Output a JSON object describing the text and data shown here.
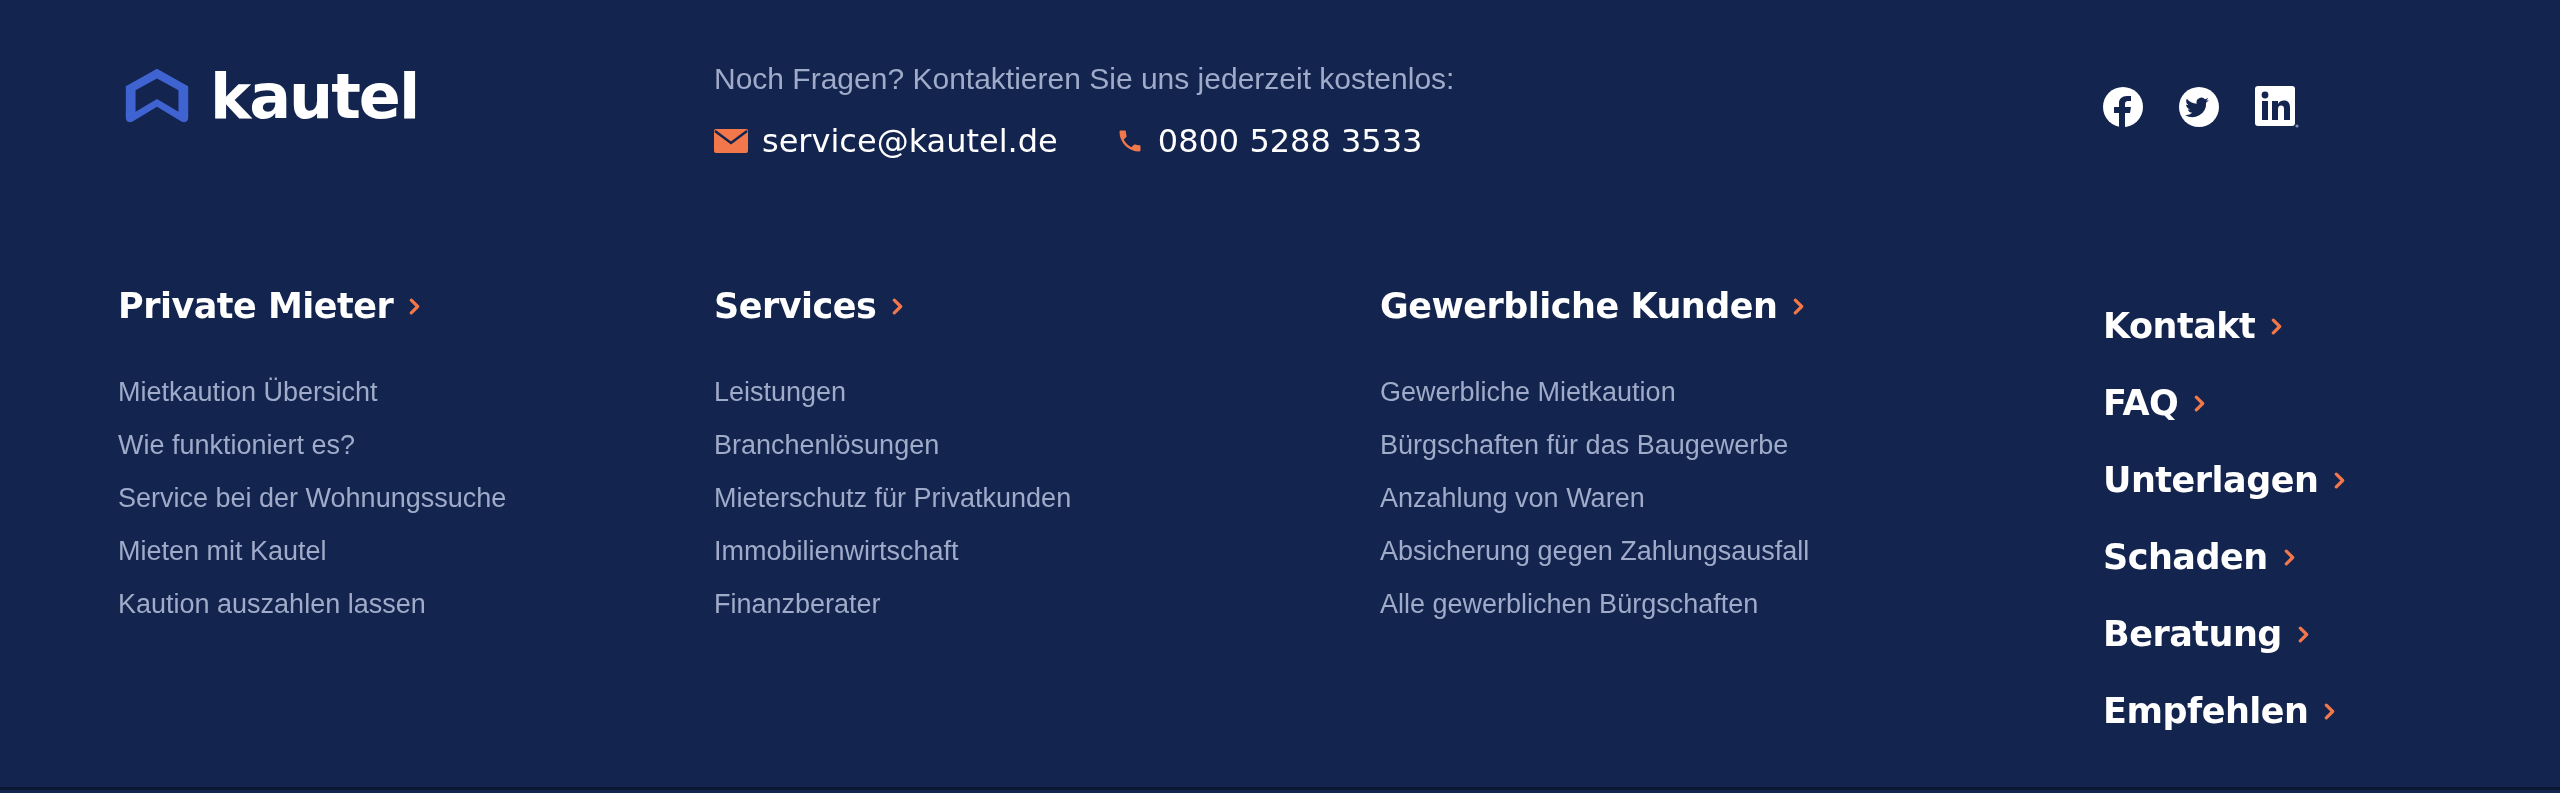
{
  "logo": {
    "text": "kautel"
  },
  "contact": {
    "headline": "Noch Fragen? Kontaktieren Sie uns jederzeit kostenlos:",
    "email": "service@kautel.de",
    "phone": "0800 5288 3533"
  },
  "social": [
    {
      "kind": "facebook"
    },
    {
      "kind": "twitter"
    },
    {
      "kind": "linkedin"
    }
  ],
  "columns": [
    {
      "title": "Private Mieter",
      "links": [
        "Mietkaution Übersicht",
        "Wie funktioniert es?",
        "Service bei der Wohnungssuche",
        "Mieten mit Kautel",
        "Kaution auszahlen lassen"
      ]
    },
    {
      "title": "Services",
      "links": [
        "Leistungen",
        "Branchenlösungen",
        "Mieterschutz für Privatkunden",
        "Immobilienwirtschaft",
        "Finanzberater"
      ]
    },
    {
      "title": "Gewerbliche Kunden",
      "links": [
        "Gewerbliche Mietkaution",
        "Bürgschaften für das Baugewerbe",
        "Anzahlung von Waren",
        "Absicherung gegen Zahlungsausfall",
        "Alle gewerblichen Bürgschaften"
      ]
    }
  ],
  "quick_links": [
    "Kontakt",
    "FAQ",
    "Unterlagen",
    "Schaden",
    "Beratung",
    "Empfehlen"
  ]
}
